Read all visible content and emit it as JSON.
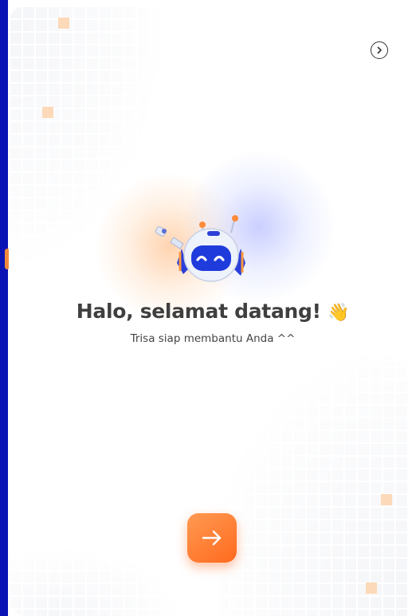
{
  "colors": {
    "frame_blue": "#0a14b4",
    "accent_orange": "#ff7a30",
    "robot_blue": "#2a44e8",
    "text_dark": "#3f3f3f"
  },
  "icons": {
    "skip": "chevron-right-circle-icon",
    "next": "arrow-right-icon",
    "greeting": "waving-hand-icon",
    "mascot": "robot-mascot"
  },
  "welcome": {
    "title": "Halo, selamat datang!",
    "wave_emoji": "👋",
    "subtitle": "Trisa siap membantu Anda ^^"
  }
}
